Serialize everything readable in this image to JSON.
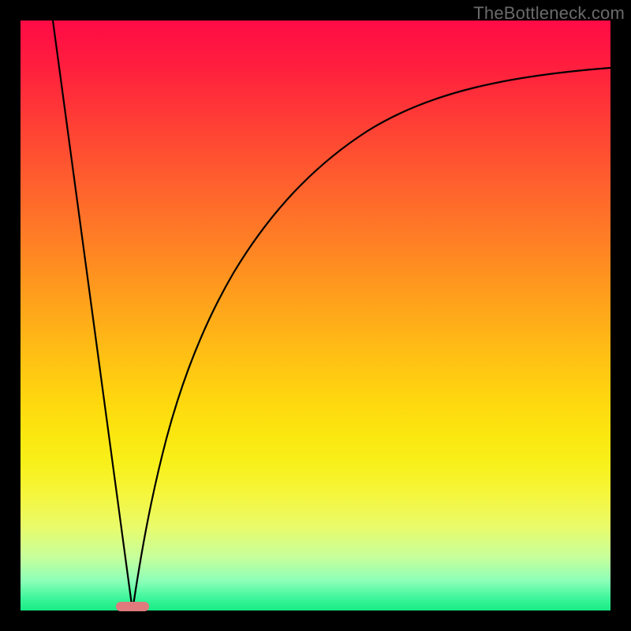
{
  "watermark": "TheBottleneck.com",
  "chart_data": {
    "type": "line",
    "title": "",
    "xlabel": "",
    "ylabel": "",
    "xlim": [
      0,
      100
    ],
    "ylim": [
      0,
      100
    ],
    "grid": false,
    "legend": false,
    "annotations": [
      {
        "name": "minimum-marker",
        "x": 19,
        "y": 0
      }
    ],
    "series": [
      {
        "name": "left-branch",
        "x": [
          5.5,
          7,
          8.5,
          10,
          11.5,
          13,
          14.5,
          16,
          17.5,
          19
        ],
        "values": [
          100,
          89,
          78,
          67,
          56,
          44,
          33,
          22,
          11,
          0
        ]
      },
      {
        "name": "right-branch",
        "x": [
          19,
          20.5,
          22,
          24,
          27,
          30,
          34,
          38,
          43,
          48,
          54,
          60,
          67,
          74,
          82,
          90,
          100
        ],
        "values": [
          0,
          10,
          19,
          29,
          40,
          49,
          57,
          63.5,
          69,
          73.5,
          77.5,
          80.5,
          83,
          85,
          87,
          88.6,
          90
        ]
      }
    ],
    "background_gradient": {
      "top": "#ff0b45",
      "mid_upper": "#ffa31b",
      "mid_lower": "#f6f63a",
      "bottom": "#17eb84"
    },
    "marker_color": "#e07a7d"
  }
}
